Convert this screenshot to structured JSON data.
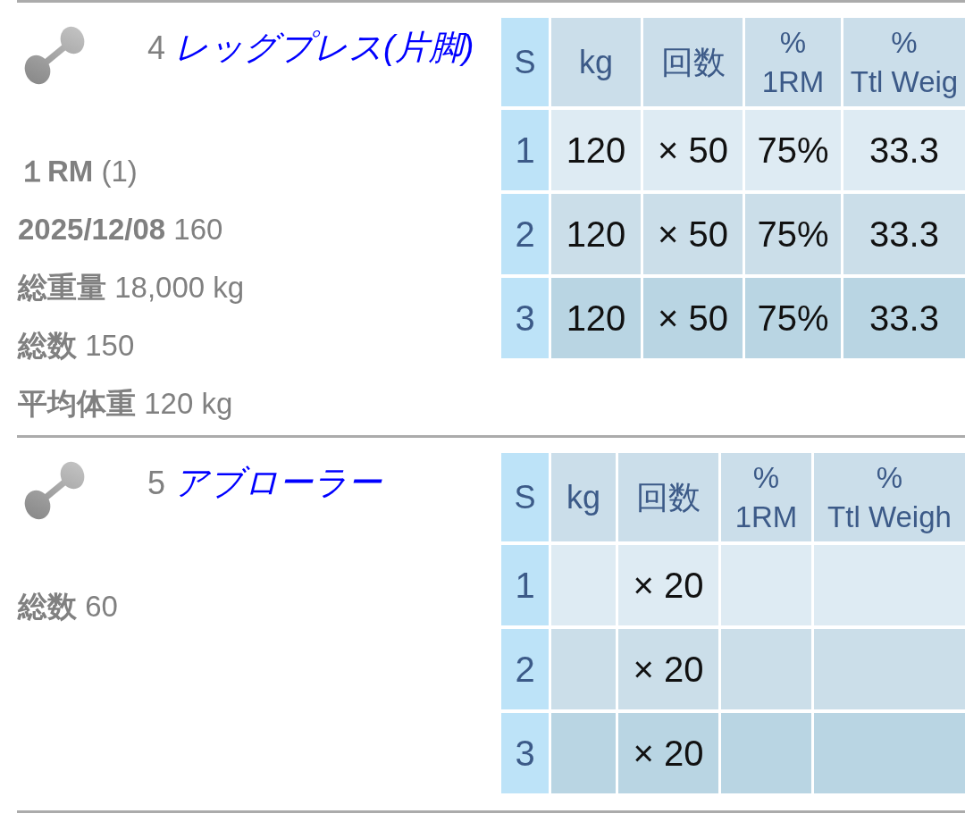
{
  "exercises": [
    {
      "number": "4",
      "name": "レッグプレス(片脚)",
      "stats": [
        {
          "label": "１RM",
          "value": "(1)"
        },
        {
          "label": "2025/12/08",
          "value": "160"
        },
        {
          "label": "総重量",
          "value": "18,000 kg"
        },
        {
          "label": "総数",
          "value": "150"
        },
        {
          "label": "平均体重",
          "value": "120 kg"
        }
      ],
      "table": {
        "columns": [
          {
            "lines": [
              "S"
            ]
          },
          {
            "lines": [
              "kg"
            ]
          },
          {
            "lines": [
              "回数"
            ]
          },
          {
            "lines": [
              "%",
              "1RM"
            ]
          },
          {
            "lines": [
              "%",
              "Ttl Weig"
            ]
          }
        ],
        "rows": [
          [
            "1",
            "120",
            "× 50",
            "75%",
            "33.3"
          ],
          [
            "2",
            "120",
            "× 50",
            "75%",
            "33.3"
          ],
          [
            "3",
            "120",
            "× 50",
            "75%",
            "33.3"
          ]
        ]
      }
    },
    {
      "number": "5",
      "name": "アブローラー",
      "stats": [
        {
          "label": "総数",
          "value": "60"
        }
      ],
      "table": {
        "columns": [
          {
            "lines": [
              "S"
            ]
          },
          {
            "lines": [
              "kg"
            ]
          },
          {
            "lines": [
              "回数"
            ]
          },
          {
            "lines": [
              "%",
              "1RM"
            ]
          },
          {
            "lines": [
              "%",
              "Ttl Weigh"
            ]
          }
        ],
        "rows": [
          [
            "1",
            null,
            "× 20",
            null,
            null
          ],
          [
            "2",
            null,
            "× 20",
            null,
            null
          ],
          [
            "3",
            null,
            "× 20",
            null,
            null
          ]
        ]
      }
    }
  ]
}
